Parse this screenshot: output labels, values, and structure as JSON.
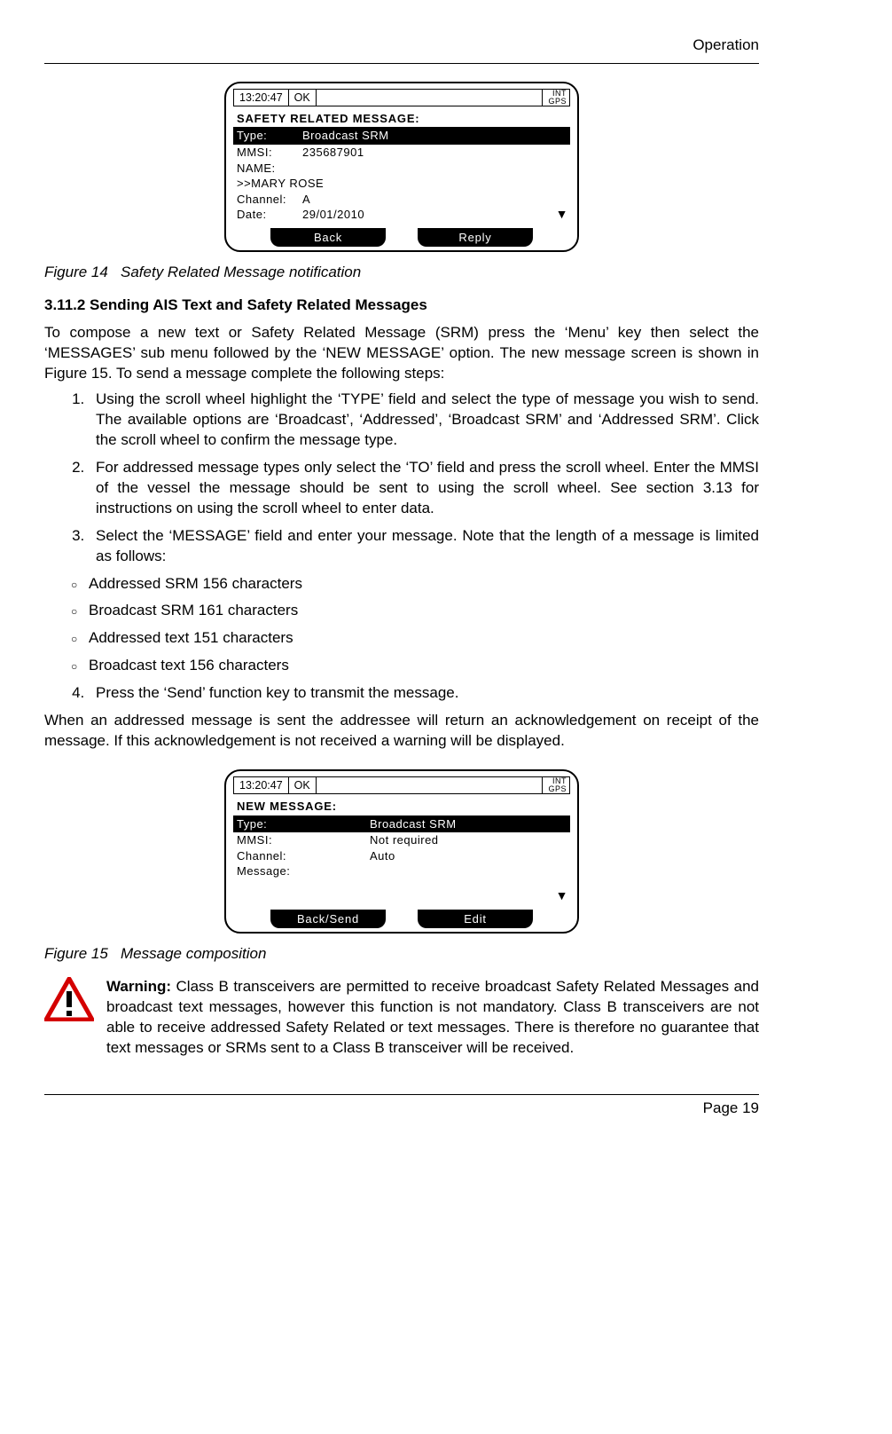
{
  "header": {
    "section": "Operation"
  },
  "figure14": {
    "caption_prefix": "Figure 14",
    "caption_text": "Safety Related Message notification",
    "screen": {
      "time": "13:20:47",
      "status": "OK",
      "indicator1": "INT",
      "indicator2": "GPS",
      "title": "SAFETY RELATED MESSAGE:",
      "type_label": "Type:",
      "type_value": "Broadcast SRM",
      "mmsi_label": "MMSI:",
      "mmsi_value": "235687901",
      "name_label": "NAME:",
      "name_value": ">>MARY ROSE",
      "channel_label": "Channel:",
      "channel_value": "A",
      "date_label": "Date:",
      "date_value": "29/01/2010",
      "softkey_left": "Back",
      "softkey_right": "Reply"
    }
  },
  "section": {
    "number_title": "3.11.2  Sending AIS Text and Safety Related Messages",
    "intro": "To compose a new text or Safety Related Message (SRM) press the ‘Menu’ key then select the ‘MESSAGES’ sub menu followed by the ‘NEW MESSAGE’ option. The new message screen is shown in Figure 15. To send a message complete the following steps:",
    "step1": "Using the scroll wheel highlight the ‘TYPE’ field and select the type of message you wish to send. The available options are ‘Broadcast’, ‘Addressed’, ‘Broadcast SRM’ and ‘Addressed SRM’. Click the scroll wheel to confirm the message type.",
    "step2": "For addressed message types only select the ‘TO’ field and press the scroll wheel. Enter the MMSI of the vessel the message should be sent to using the scroll wheel. See section 3.13 for instructions on using the scroll wheel to enter data.",
    "step3": "Select the ‘MESSAGE’ field and enter your message. Note that the length of a message is limited as follows:",
    "bullets": {
      "b1": "Addressed SRM 156 characters",
      "b2": "Broadcast SRM 161 characters",
      "b3": "Addressed text 151 characters",
      "b4": "Broadcast text 156 characters"
    },
    "step4": "Press the ‘Send’ function key to transmit the message.",
    "closing": "When an addressed message is sent the addressee will return an acknowledgement on receipt of the message. If this acknowledgement is not received a warning will be displayed."
  },
  "figure15": {
    "caption_prefix": "Figure 15",
    "caption_text": "Message composition",
    "screen": {
      "time": "13:20:47",
      "status": "OK",
      "indicator1": "INT",
      "indicator2": "GPS",
      "title": "NEW MESSAGE:",
      "type_label": "Type:",
      "type_value": "Broadcast SRM",
      "mmsi_label": "MMSI:",
      "mmsi_value": "Not required",
      "channel_label": "Channel:",
      "channel_value": "Auto",
      "message_label": "Message:",
      "softkey_left": "Back/Send",
      "softkey_right": "Edit"
    }
  },
  "warning": {
    "label": "Warning:",
    "text": " Class B transceivers are permitted to receive broadcast Safety Related Messages and broadcast text messages, however this function is not mandatory. Class B transceivers are not able to receive addressed Safety Related or text messages. There is therefore no guarantee that text messages or SRMs sent to a Class B transceiver will be received."
  },
  "footer": {
    "page": "Page 19"
  }
}
